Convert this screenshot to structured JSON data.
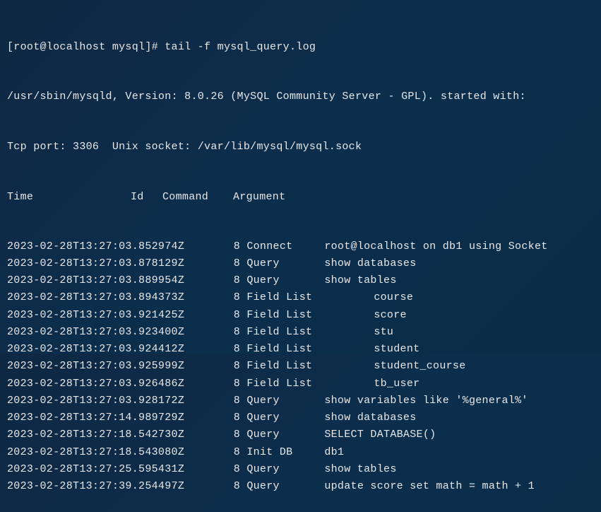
{
  "prompt": "[root@localhost mysql]# tail -f mysql_query.log",
  "header1": "/usr/sbin/mysqld, Version: 8.0.26 (MySQL Community Server - GPL). started with:",
  "header2": "Tcp port: 3306  Unix socket: /var/lib/mysql/mysql.sock",
  "columns": {
    "time": "Time",
    "id": "Id",
    "command": "Command",
    "argument": "Argument"
  },
  "rows": [
    {
      "time": "2023-02-28T13:27:03.852974Z",
      "id": "8",
      "command": "Connect",
      "argument": "root@localhost on db1 using Socket"
    },
    {
      "time": "2023-02-28T13:27:03.878129Z",
      "id": "8",
      "command": "Query",
      "argument": "show databases"
    },
    {
      "time": "2023-02-28T13:27:03.889954Z",
      "id": "8",
      "command": "Query",
      "argument": "show tables"
    },
    {
      "time": "2023-02-28T13:27:03.894373Z",
      "id": "8",
      "command": "Field List",
      "argument": "course",
      "fieldlist": true
    },
    {
      "time": "2023-02-28T13:27:03.921425Z",
      "id": "8",
      "command": "Field List",
      "argument": "score",
      "fieldlist": true
    },
    {
      "time": "2023-02-28T13:27:03.923400Z",
      "id": "8",
      "command": "Field List",
      "argument": "stu",
      "fieldlist": true
    },
    {
      "time": "2023-02-28T13:27:03.924412Z",
      "id": "8",
      "command": "Field List",
      "argument": "student",
      "fieldlist": true
    },
    {
      "time": "2023-02-28T13:27:03.925999Z",
      "id": "8",
      "command": "Field List",
      "argument": "student_course",
      "fieldlist": true
    },
    {
      "time": "2023-02-28T13:27:03.926486Z",
      "id": "8",
      "command": "Field List",
      "argument": "tb_user",
      "fieldlist": true
    },
    {
      "time": "2023-02-28T13:27:03.928172Z",
      "id": "8",
      "command": "Query",
      "argument": "show variables like '%general%'"
    },
    {
      "time": "2023-02-28T13:27:14.989729Z",
      "id": "8",
      "command": "Query",
      "argument": "show databases"
    },
    {
      "time": "2023-02-28T13:27:18.542730Z",
      "id": "8",
      "command": "Query",
      "argument": "SELECT DATABASE()"
    },
    {
      "time": "2023-02-28T13:27:18.543080Z",
      "id": "8",
      "command": "Init DB",
      "argument": "db1"
    },
    {
      "time": "2023-02-28T13:27:25.595431Z",
      "id": "8",
      "command": "Query",
      "argument": "show tables"
    },
    {
      "time": "2023-02-28T13:27:39.254497Z",
      "id": "8",
      "command": "Query",
      "argument": "update score set math = math + 1"
    }
  ]
}
